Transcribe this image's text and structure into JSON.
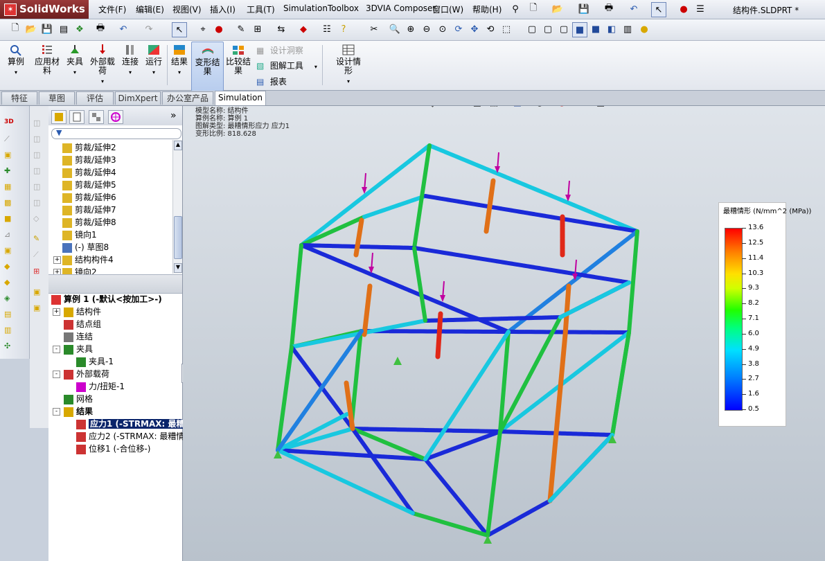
{
  "app": {
    "logo": "SolidWorks",
    "document_title": "结构件.SLDPRT *"
  },
  "menu": [
    "文件(F)",
    "编辑(E)",
    "视图(V)",
    "插入(I)",
    "工具(T)",
    "Simulation",
    "Toolbox",
    "3DVIA Composer",
    "窗口(W)",
    "帮助(H)"
  ],
  "ribbon": {
    "study": "算例",
    "apply_material": "应用材料",
    "fixtures": "夹具",
    "external_loads": "外部载荷",
    "connections": "连接",
    "run": "运行",
    "results": "结果",
    "deformed_result": "变形结果",
    "compare_results": "比较结果",
    "design_insight": "设计洞察",
    "plot_tools": "图解工具",
    "report": "报表",
    "design_scenario": "设计情形"
  },
  "tabs": [
    "特征",
    "草图",
    "评估",
    "DimXpert",
    "办公室产品",
    "Simulation"
  ],
  "feature_tree": {
    "items": [
      {
        "label": "剪裁/延伸2",
        "icon": "trim-extend-icon"
      },
      {
        "label": "剪裁/延伸3",
        "icon": "trim-extend-icon"
      },
      {
        "label": "剪裁/延伸4",
        "icon": "trim-extend-icon"
      },
      {
        "label": "剪裁/延伸5",
        "icon": "trim-extend-icon"
      },
      {
        "label": "剪裁/延伸6",
        "icon": "trim-extend-icon"
      },
      {
        "label": "剪裁/延伸7",
        "icon": "trim-extend-icon"
      },
      {
        "label": "剪裁/延伸8",
        "icon": "trim-extend-icon"
      },
      {
        "label": "镜向1",
        "icon": "mirror-icon"
      },
      {
        "label": "(-) 草图8",
        "icon": "sketch-icon"
      },
      {
        "label": "结构构件4",
        "icon": "weldment-icon"
      },
      {
        "label": "镜向2",
        "icon": "mirror-icon"
      }
    ]
  },
  "study_tree": {
    "root": "算例 1 (-默认<按加工>-)",
    "items": [
      {
        "label": "结构件",
        "level": 1,
        "expander": "+"
      },
      {
        "label": "结点组",
        "level": 1,
        "expander": ""
      },
      {
        "label": "连结",
        "level": 1,
        "expander": ""
      },
      {
        "label": "夹具",
        "level": 1,
        "expander": "-"
      },
      {
        "label": "夹具-1",
        "level": 2,
        "expander": ""
      },
      {
        "label": "外部载荷",
        "level": 1,
        "expander": "-"
      },
      {
        "label": "力/扭矩-1",
        "level": 2,
        "expander": ""
      },
      {
        "label": "网格",
        "level": 1,
        "expander": ""
      },
      {
        "label": "结果",
        "level": 1,
        "expander": "-"
      },
      {
        "label": "应力1 (-STRMAX: 最糟",
        "level": 2,
        "expander": "",
        "selected": true
      },
      {
        "label": "应力2 (-STRMAX: 最糟情",
        "level": 2,
        "expander": ""
      },
      {
        "label": "位移1 (-合位移-)",
        "level": 2,
        "expander": ""
      }
    ]
  },
  "viewport_info": {
    "model_name": "模型名称: 结构件",
    "study_name": "算例名称: 算例 1",
    "plot_type": "图解类型: 最糟情形应力 应力1",
    "deformation_scale": "变形比例: 818.628"
  },
  "legend": {
    "title": "最糟情形 (N/mm^2 (MPa))",
    "values": [
      "13.6",
      "12.5",
      "11.4",
      "10.3",
      "9.3",
      "8.2",
      "7.1",
      "6.0",
      "4.9",
      "3.8",
      "2.7",
      "1.6",
      "0.5"
    ]
  },
  "colors": {
    "selection": "#0a246a",
    "accent": "#316ac5",
    "stress_high": "#ff0000",
    "stress_low": "#0000ff",
    "load_arrow": "#c000a0"
  }
}
